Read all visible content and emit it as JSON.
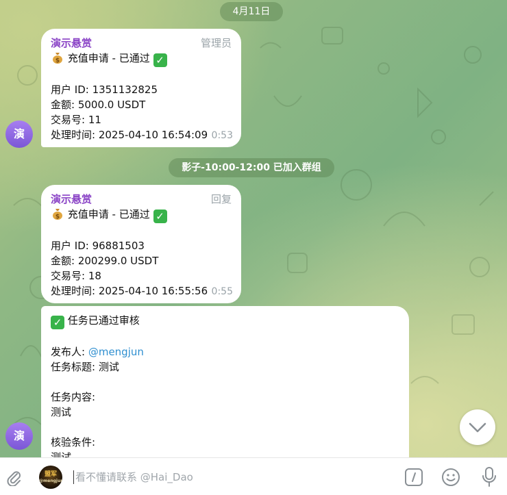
{
  "date_label": "4月11日",
  "service_message": "影子-10:00-12:00 已加入群组",
  "messages": [
    {
      "sender": "演示悬赏",
      "role": "管理员",
      "title": "充值申请 - 已通过",
      "user_id": "用户 ID: 1351132825",
      "amount": "金额: 5000.0 USDT",
      "tx_no": "交易号: 11",
      "processed": "处理时间: 2025-04-10 16:54:09",
      "time": "0:53"
    },
    {
      "sender": "演示悬赏",
      "role": "回复",
      "title": "充值申请 - 已通过",
      "user_id": "用户 ID: 96881503",
      "amount": "金额: 200299.0 USDT",
      "tx_no": "交易号: 18",
      "processed": "处理时间: 2025-04-10 16:55:56",
      "time": "0:55"
    },
    {
      "title": "任务已通过审核",
      "publisher_label": "发布人: ",
      "publisher_handle": "@mengjun",
      "task_title": "任务标题: 测试",
      "task_content_label": "任务内容:",
      "task_content": "测试",
      "verify_label": "核验条件:",
      "verify_value": "测试"
    }
  ],
  "avatar_letter": "演",
  "bot_avatar_text": "盟军",
  "bot_avatar_sub": "@mengjun",
  "composer_placeholder": "看不懂请联系 @Hai_Dao",
  "colors": {
    "sender": "#8a43c6",
    "link": "#2f8fd0",
    "avatar": "#8e68e3",
    "check": "#38b34a"
  },
  "icons": [
    "attach-icon",
    "command-icon",
    "emoji-icon",
    "microphone-icon",
    "chevron-down-icon",
    "money-bag-icon",
    "check-mark-icon"
  ]
}
